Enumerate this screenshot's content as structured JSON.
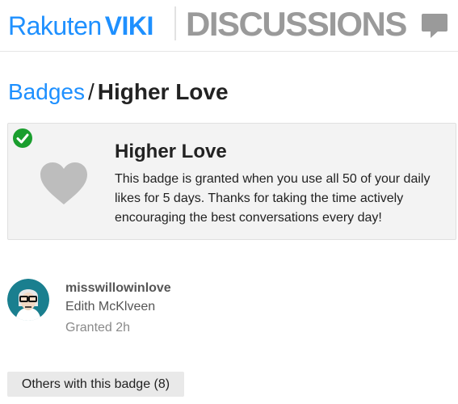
{
  "header": {
    "logo_brand": "Rakuten",
    "logo_product": "VIKI",
    "section_title": "DISCUSSIONS",
    "icon": "speech-bubble-icon",
    "colors": {
      "brand_blue": "#1e90ff",
      "section_gray": "#9a9a9a"
    }
  },
  "breadcrumb": {
    "parent": "Badges",
    "separator": "/",
    "current": "Higher Love"
  },
  "badge": {
    "title": "Higher Love",
    "description": "This badge is granted when you use all 50 of your daily likes for 5 days. Thanks for taking the time actively encouraging the best conversations every day!",
    "icon": "heart-icon",
    "status_icon": "check-icon",
    "colors": {
      "check_green": "#1a9e2e",
      "heart_gray": "#bdbdbd",
      "card_bg": "#f3f3f3"
    }
  },
  "granted_user": {
    "username": "misswillowinlove",
    "full_name": "Edith McKlveen",
    "granted": "Granted 2h",
    "avatar_icon": "avatar-icon"
  },
  "actions": {
    "others_label": "Others with this badge (8)"
  }
}
